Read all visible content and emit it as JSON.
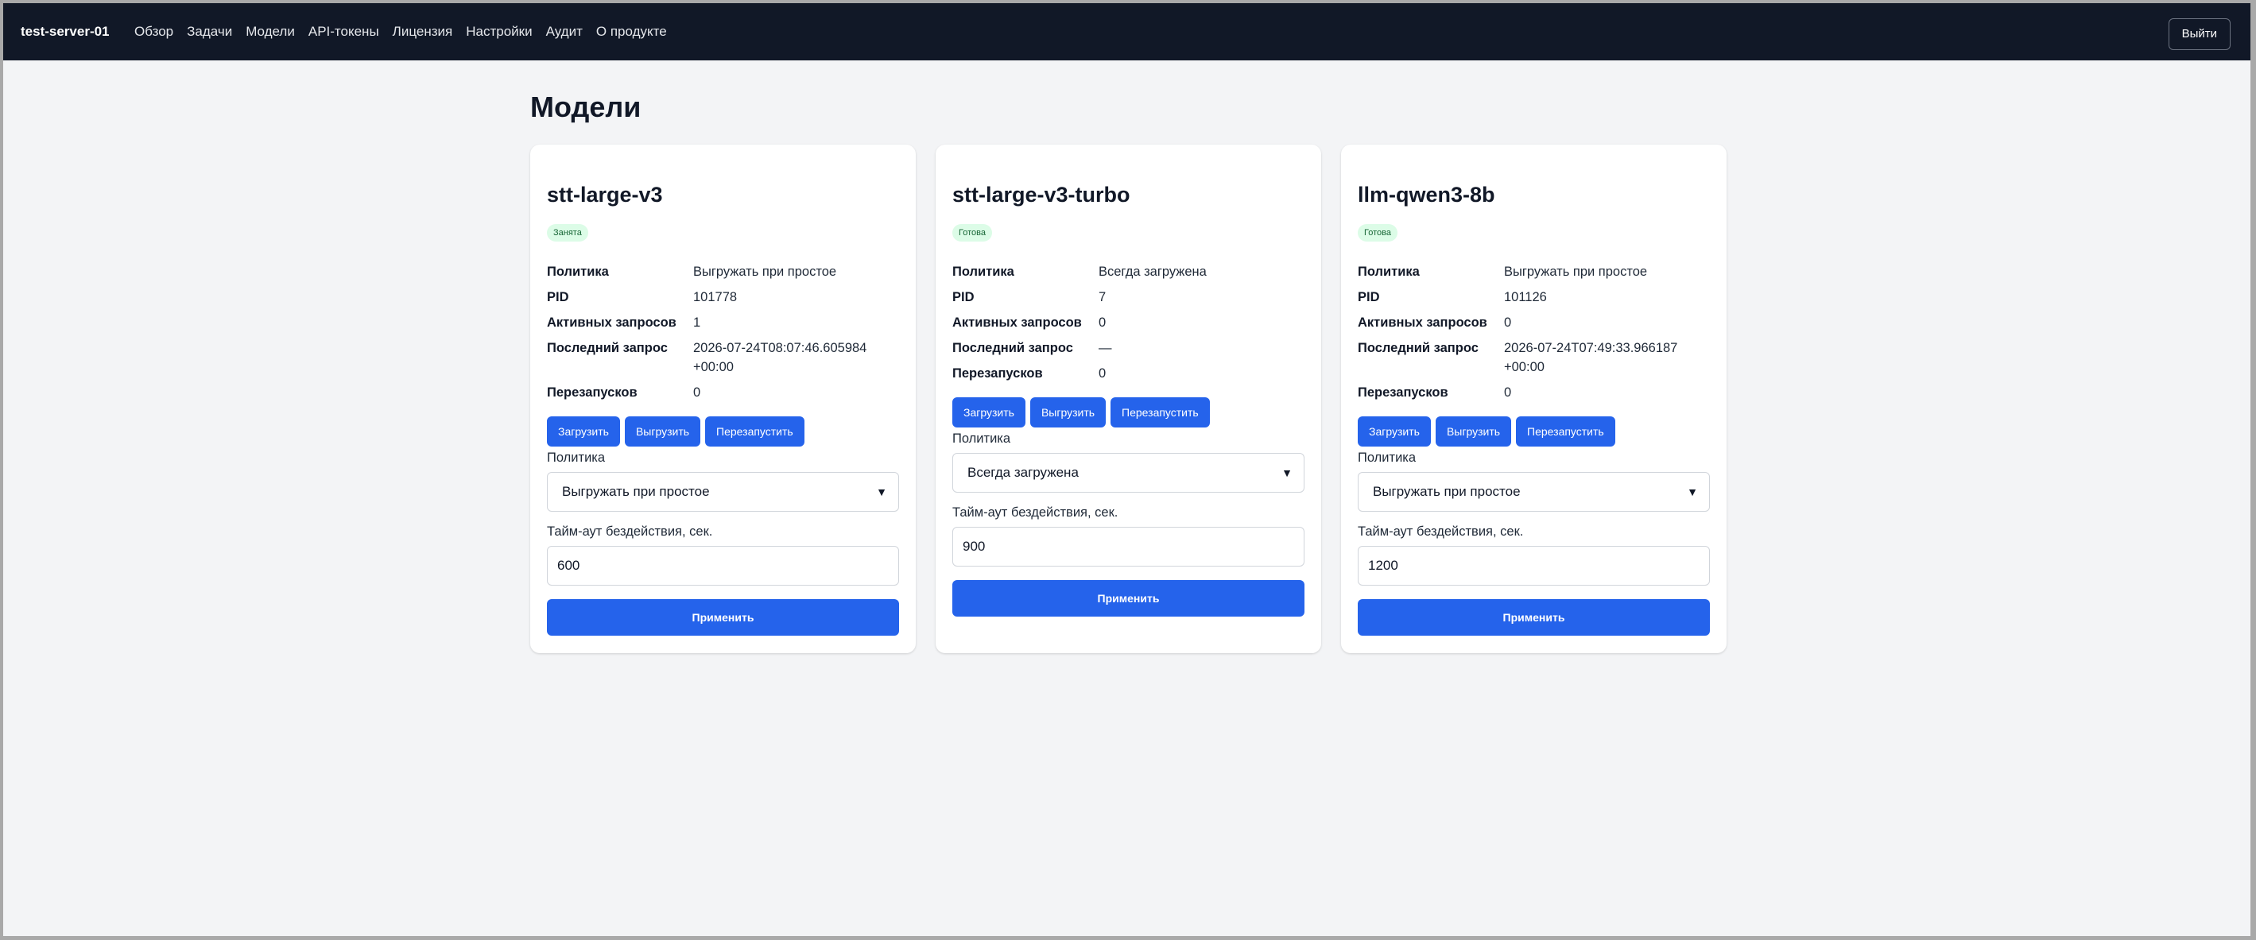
{
  "header": {
    "brand": "test-server-01",
    "nav": [
      "Обзор",
      "Задачи",
      "Модели",
      "API-токены",
      "Лицензия",
      "Настройки",
      "Аудит",
      "О продукте"
    ],
    "logout_label": "Выйти"
  },
  "page_title": "Модели",
  "labels": {
    "policy": "Политика",
    "pid": "PID",
    "active_requests": "Активных запросов",
    "last_request": "Последний запрос",
    "restarts": "Перезапусков",
    "load": "Загрузить",
    "unload": "Выгрузить",
    "restart": "Перезапустить",
    "policy_field": "Политика",
    "timeout_field": "Тайм-аут бездействия, сек.",
    "apply": "Применить"
  },
  "cards": [
    {
      "name": "stt-large-v3",
      "status": "Занята",
      "policy": "Выгружать при простое",
      "pid": "101778",
      "active_requests": "1",
      "last_request": "2026-07-24T08:07:46.605984+00:00",
      "restarts": "0",
      "policy_select": "Выгружать при простое",
      "timeout": "600"
    },
    {
      "name": "stt-large-v3-turbo",
      "status": "Готова",
      "policy": "Всегда загружена",
      "pid": "7",
      "active_requests": "0",
      "last_request": "—",
      "restarts": "0",
      "policy_select": "Всегда загружена",
      "timeout": "900"
    },
    {
      "name": "llm-qwen3-8b",
      "status": "Готова",
      "policy": "Выгружать при простое",
      "pid": "101126",
      "active_requests": "0",
      "last_request": "2026-07-24T07:49:33.966187+00:00",
      "restarts": "0",
      "policy_select": "Выгружать при простое",
      "timeout": "1200"
    }
  ],
  "icons": {
    "select_arrow": "chevron-down-icon"
  },
  "colors": {
    "topbar": "#111827",
    "accent": "#2563eb",
    "badge_bg": "#dcfce7",
    "badge_text": "#166534"
  }
}
